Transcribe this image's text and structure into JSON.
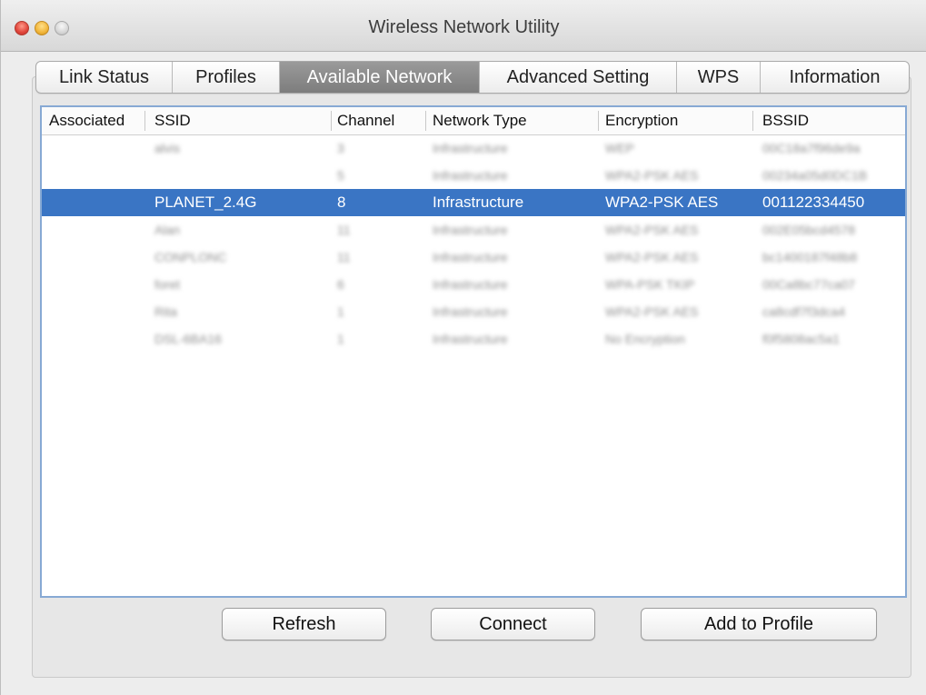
{
  "window": {
    "title": "Wireless Network Utility"
  },
  "tabs": [
    {
      "label": "Link Status",
      "active": false
    },
    {
      "label": "Profiles",
      "active": false
    },
    {
      "label": "Available Network",
      "active": true
    },
    {
      "label": "Advanced Setting",
      "active": false
    },
    {
      "label": "WPS",
      "active": false
    },
    {
      "label": "Information",
      "active": false
    }
  ],
  "table": {
    "columns": [
      "Associated",
      "SSID",
      "Channel",
      "Network Type",
      "Encryption",
      "BSSID"
    ],
    "rows": [
      {
        "associated": "",
        "ssid": "alvis",
        "channel": "3",
        "type": "Infrastructure",
        "encryption": "WEP",
        "bssid": "00C18a7f96de9a",
        "blurred": true
      },
      {
        "associated": "",
        "ssid": "",
        "channel": "5",
        "type": "Infrastructure",
        "encryption": "WPA2-PSK AES",
        "bssid": "00234a05d0DC1B",
        "blurred": true
      },
      {
        "associated": "",
        "ssid": "PLANET_2.4G",
        "channel": "8",
        "type": "Infrastructure",
        "encryption": "WPA2-PSK AES",
        "bssid": "001122334450",
        "blurred": false,
        "selected": true
      },
      {
        "associated": "",
        "ssid": "Alan",
        "channel": "11",
        "type": "Infrastructure",
        "encryption": "WPA2-PSK AES",
        "bssid": "002E05bcd4578",
        "blurred": true
      },
      {
        "associated": "",
        "ssid": "CONPLONC",
        "channel": "11",
        "type": "Infrastructure",
        "encryption": "WPA2-PSK AES",
        "bssid": "bc1400187f48b8",
        "blurred": true
      },
      {
        "associated": "",
        "ssid": "foret",
        "channel": "6",
        "type": "Infrastructure",
        "encryption": "WPA-PSK TKIP",
        "bssid": "00Ca8bc77ca07",
        "blurred": true
      },
      {
        "associated": "",
        "ssid": "Rita",
        "channel": "1",
        "type": "Infrastructure",
        "encryption": "WPA2-PSK AES",
        "bssid": "ca8cdf7f3dca4",
        "blurred": true
      },
      {
        "associated": "",
        "ssid": "DSL-6BA16",
        "channel": "1",
        "type": "Infrastructure",
        "encryption": "No Encryption",
        "bssid": "f0f5808ac5a1",
        "blurred": true
      }
    ]
  },
  "buttons": {
    "refresh": "Refresh",
    "connect": "Connect",
    "add_to_profile": "Add to Profile"
  },
  "colors": {
    "selection": "#3a75c4",
    "active_tab": "#8a8a8a",
    "list_border": "#87a9d4"
  }
}
